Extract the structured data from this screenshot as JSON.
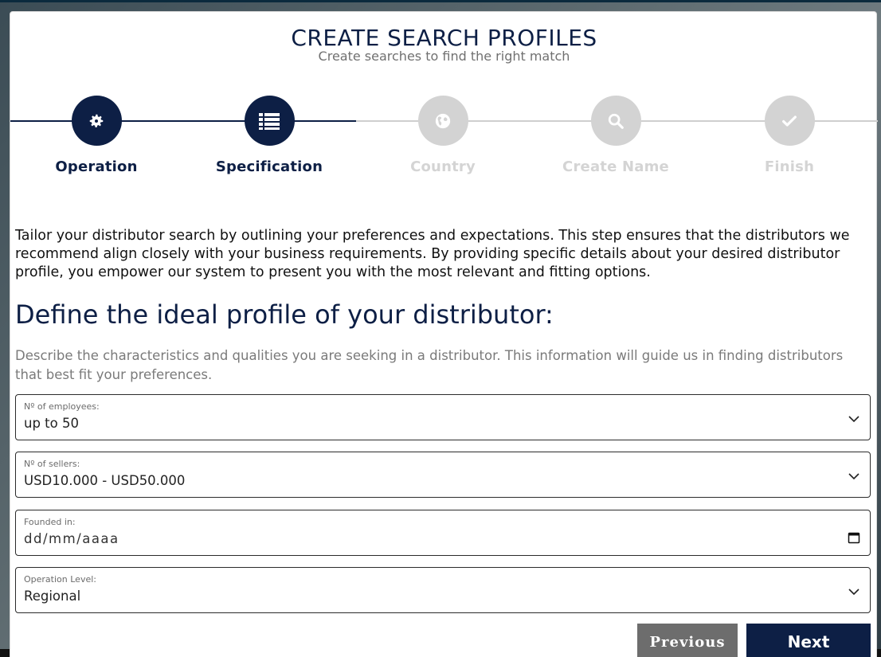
{
  "page": {
    "title": "CREATE SEARCH PROFILES",
    "subtitle": "Create searches to find the right match"
  },
  "steps": [
    {
      "label": "Operation",
      "icon": "gear-icon",
      "state": "completed"
    },
    {
      "label": "Specification",
      "icon": "list-icon",
      "state": "current"
    },
    {
      "label": "Country",
      "icon": "globe-icon",
      "state": "pending"
    },
    {
      "label": "Create Name",
      "icon": "search-icon",
      "state": "pending"
    },
    {
      "label": "Finish",
      "icon": "check-icon",
      "state": "pending"
    }
  ],
  "intro": "Tailor your distributor search by outlining your preferences and expectations. This step ensures that the distributors we recommend align closely with your business requirements. By providing specific details about your desired distributor profile, you empower our system to present you with the most relevant and fitting options.",
  "section": {
    "heading": "Define the ideal profile of your distributor:",
    "description": "Describe the characteristics and qualities you are seeking in a distributor. This information will guide us in finding distributors that best fit your preferences."
  },
  "fields": {
    "employees": {
      "label": "Nº of employees:",
      "value": "up to 50"
    },
    "sellers": {
      "label": "Nº of sellers:",
      "value": "USD10.000 - USD50.000"
    },
    "founded": {
      "label": "Founded in:",
      "placeholder": "dd/mm/aaaa"
    },
    "operation_level": {
      "label": "Operation Level:",
      "value": "Regional"
    }
  },
  "buttons": {
    "previous": "Previous",
    "next": "Next"
  },
  "colors": {
    "primary": "#0d1f45",
    "inactive": "#d3d3d3",
    "previous_button": "#6d6d6d"
  }
}
